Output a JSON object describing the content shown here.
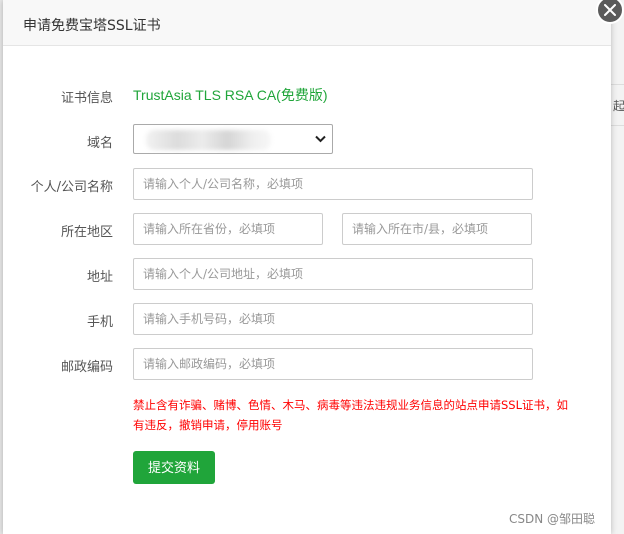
{
  "dialog": {
    "title": "申请免费宝塔SSL证书",
    "close_icon": "close-icon"
  },
  "form": {
    "cert_info_label": "证书信息",
    "cert_info_value": "TrustAsia TLS RSA CA(免费版)",
    "domain_label": "域名",
    "domain_value": "",
    "name_label": "个人/公司名称",
    "name_placeholder": "请输入个人/公司名称，必填项",
    "region_label": "所在地区",
    "province_placeholder": "请输入所在省份，必填项",
    "city_placeholder": "请输入所在市/县，必填项",
    "address_label": "地址",
    "address_placeholder": "请输入个人/公司地址，必填项",
    "phone_label": "手机",
    "phone_placeholder": "请输入手机号码，必填项",
    "postcode_label": "邮政编码",
    "postcode_placeholder": "请输入邮政编码，必填项",
    "warning": "禁止含有诈骗、赌博、色情、木马、病毒等违法违规业务信息的站点申请SSL证书，如有违反，撤销申请，停用账号",
    "submit_label": "提交资料"
  },
  "background": {
    "partial_text": "起路"
  },
  "watermark": "CSDN @邹田聪",
  "colors": {
    "accent": "#20a53a",
    "warning": "#ff0000"
  }
}
